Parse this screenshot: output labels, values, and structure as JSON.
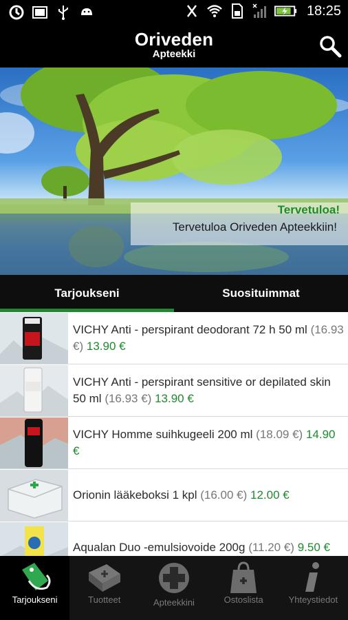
{
  "status_bar": {
    "time": "18:25",
    "icons": [
      "sync-icon",
      "screen-icon",
      "usb-icon",
      "android-icon",
      "mute-icon",
      "wifi-icon",
      "sim-icon",
      "signal-icon",
      "battery-charging-icon"
    ]
  },
  "header": {
    "title": "Oriveden",
    "subtitle": "Apteekki",
    "search_icon": "search-icon"
  },
  "banner": {
    "title": "Tervetuloa!",
    "text": "Tervetuloa Oriveden Apteekkiin!"
  },
  "tabs": [
    {
      "label": "Tarjoukseni",
      "active": true
    },
    {
      "label": "Suosituimmat",
      "active": false
    }
  ],
  "products": [
    {
      "name": "VICHY Anti - perspirant deodorant 72 h 50 ml",
      "old_price": "(16.93 €)",
      "new_price": "13.90 €"
    },
    {
      "name": "VICHY Anti - perspirant sensitive or depilated skin 50 ml",
      "old_price": "(16.93 €)",
      "new_price": "13.90 €"
    },
    {
      "name": "VICHY Homme suihkugeeli 200 ml",
      "old_price": "(18.09 €)",
      "new_price": "14.90 €"
    },
    {
      "name": "Orionin lääkeboksi 1 kpl",
      "old_price": "(16.00 €)",
      "new_price": "12.00 €"
    },
    {
      "name": "Aqualan Duo -emulsiovoide 200g",
      "old_price": "(11.20 €)",
      "new_price": "9.50 €"
    }
  ],
  "bottom_nav": [
    {
      "label": "Tarjoukseni",
      "icon": "offer-tag-icon",
      "active": true
    },
    {
      "label": "Tuotteet",
      "icon": "products-icon",
      "active": false
    },
    {
      "label": "Apteekkini",
      "icon": "pharmacy-cross-icon",
      "active": false
    },
    {
      "label": "Ostoslista",
      "icon": "shopping-bag-icon",
      "active": false
    },
    {
      "label": "Yhteystiedot",
      "icon": "info-icon",
      "active": false
    }
  ],
  "colors": {
    "accent_green": "#1e8a2e",
    "background": "#000000",
    "list_bg": "#ffffff"
  }
}
